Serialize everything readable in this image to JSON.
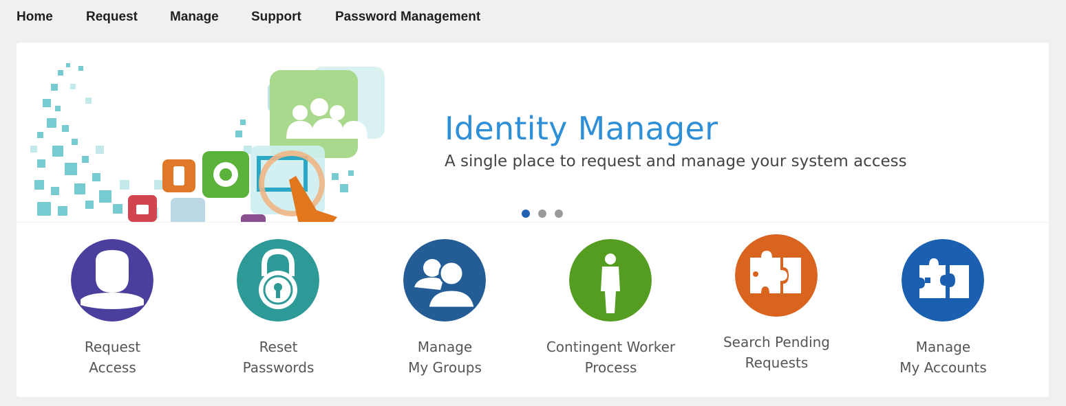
{
  "nav": {
    "items": [
      {
        "label": "Home"
      },
      {
        "label": "Request"
      },
      {
        "label": "Manage"
      },
      {
        "label": "Support"
      },
      {
        "label": "Password Management"
      }
    ]
  },
  "hero": {
    "title": "Identity Manager",
    "subtitle": "A single place to request and manage your system access",
    "carousel": {
      "slide_count": 3,
      "active_index": 0
    }
  },
  "tiles": [
    {
      "line1": "Request",
      "line2": "Access",
      "icon": "user-icon",
      "color": "#4a3f9c"
    },
    {
      "line1": "Reset",
      "line2": "Passwords",
      "icon": "padlock-icon",
      "color": "#2e9a97"
    },
    {
      "line1": "Manage",
      "line2": "My Groups",
      "icon": "group-icon",
      "color": "#245d95"
    },
    {
      "line1": "Contingent Worker",
      "line2": "Process",
      "icon": "worker-icon",
      "color": "#559d20"
    },
    {
      "line1": "Search Pending",
      "line2": "Requests",
      "icon": "puzzle-icon",
      "color": "#d9641f"
    },
    {
      "line1": "Manage",
      "line2": "My Accounts",
      "icon": "puzzle-accounts-icon",
      "color": "#1b5fb0"
    }
  ],
  "colors": {
    "accent": "#2f8fd6",
    "dot_active": "#1f62b4",
    "dot_inactive": "#9a9a9a"
  }
}
